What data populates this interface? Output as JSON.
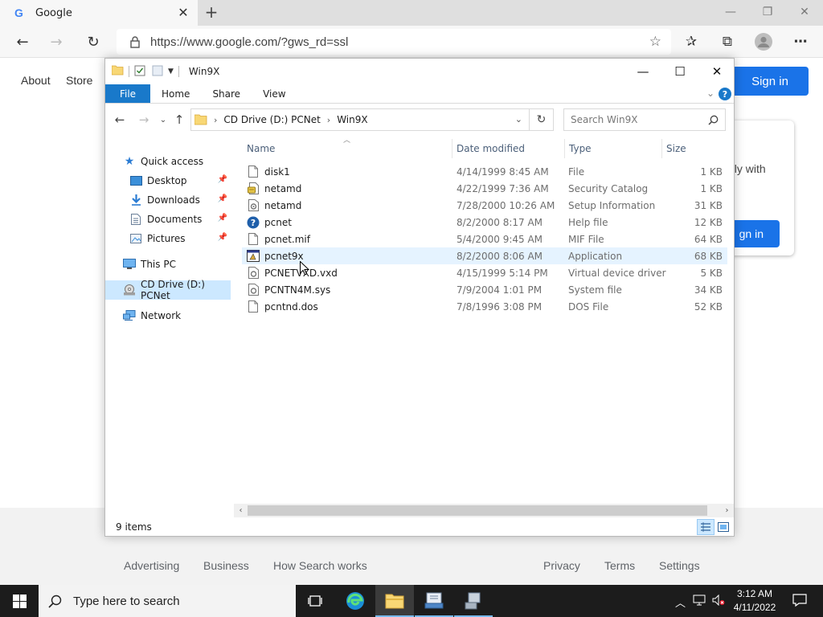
{
  "browser": {
    "tab_title": "Google",
    "new_tab_icon": "plus-icon",
    "url": "https://www.google.com/?gws_rd=ssl"
  },
  "google": {
    "nav_left": [
      "About",
      "Store"
    ],
    "signin_label": "Sign in",
    "card_text": "ely with",
    "card_button": "gn in",
    "footer_left": [
      "Advertising",
      "Business",
      "How Search works"
    ],
    "footer_right": [
      "Privacy",
      "Terms",
      "Settings"
    ],
    "accent": "#1a73e8"
  },
  "explorer": {
    "title": "Win9X",
    "ribbon_tabs": [
      "File",
      "Home",
      "Share",
      "View"
    ],
    "breadcrumb": [
      "CD Drive (D:) PCNet",
      "Win9X"
    ],
    "search_placeholder": "Search Win9X",
    "nav": {
      "quick_access": "Quick access",
      "pinned": [
        "Desktop",
        "Downloads",
        "Documents",
        "Pictures"
      ],
      "this_pc": "This PC",
      "cd_drive": "CD Drive (D:) PCNet",
      "network": "Network"
    },
    "columns": {
      "name": "Name",
      "date": "Date modified",
      "type": "Type",
      "size": "Size"
    },
    "files": [
      {
        "name": "disk1",
        "date": "4/14/1999 8:45 AM",
        "type": "File",
        "size": "1 KB",
        "icon": "file-icon"
      },
      {
        "name": "netamd",
        "date": "4/22/1999 7:36 AM",
        "type": "Security Catalog",
        "size": "1 KB",
        "icon": "security-catalog-icon"
      },
      {
        "name": "netamd",
        "date": "7/28/2000 10:26 AM",
        "type": "Setup Information",
        "size": "31 KB",
        "icon": "setup-info-icon"
      },
      {
        "name": "pcnet",
        "date": "8/2/2000 8:17 AM",
        "type": "Help file",
        "size": "12 KB",
        "icon": "help-file-icon"
      },
      {
        "name": "pcnet.mif",
        "date": "5/4/2000 9:45 AM",
        "type": "MIF File",
        "size": "64 KB",
        "icon": "file-icon"
      },
      {
        "name": "pcnet9x",
        "date": "8/2/2000 8:06 AM",
        "type": "Application",
        "size": "68 KB",
        "icon": "application-icon"
      },
      {
        "name": "PCNETVXD.vxd",
        "date": "4/15/1999 5:14 PM",
        "type": "Virtual device driver",
        "size": "5 KB",
        "icon": "system-file-icon"
      },
      {
        "name": "PCNTN4M.sys",
        "date": "7/9/2004 1:01 PM",
        "type": "System file",
        "size": "34 KB",
        "icon": "system-file-icon"
      },
      {
        "name": "pcntnd.dos",
        "date": "7/8/1996 3:08 PM",
        "type": "DOS File",
        "size": "52 KB",
        "icon": "file-icon"
      }
    ],
    "item_count": "9 items",
    "accent": "#1979ca",
    "selection_color": "#cce8ff"
  },
  "taskbar": {
    "search_placeholder": "Type here to search",
    "time": "3:12 AM",
    "date": "4/11/2022",
    "apps": [
      "task-view-icon",
      "edge-icon",
      "file-explorer-icon",
      "network-setup-icon",
      "computer-icon"
    ]
  }
}
